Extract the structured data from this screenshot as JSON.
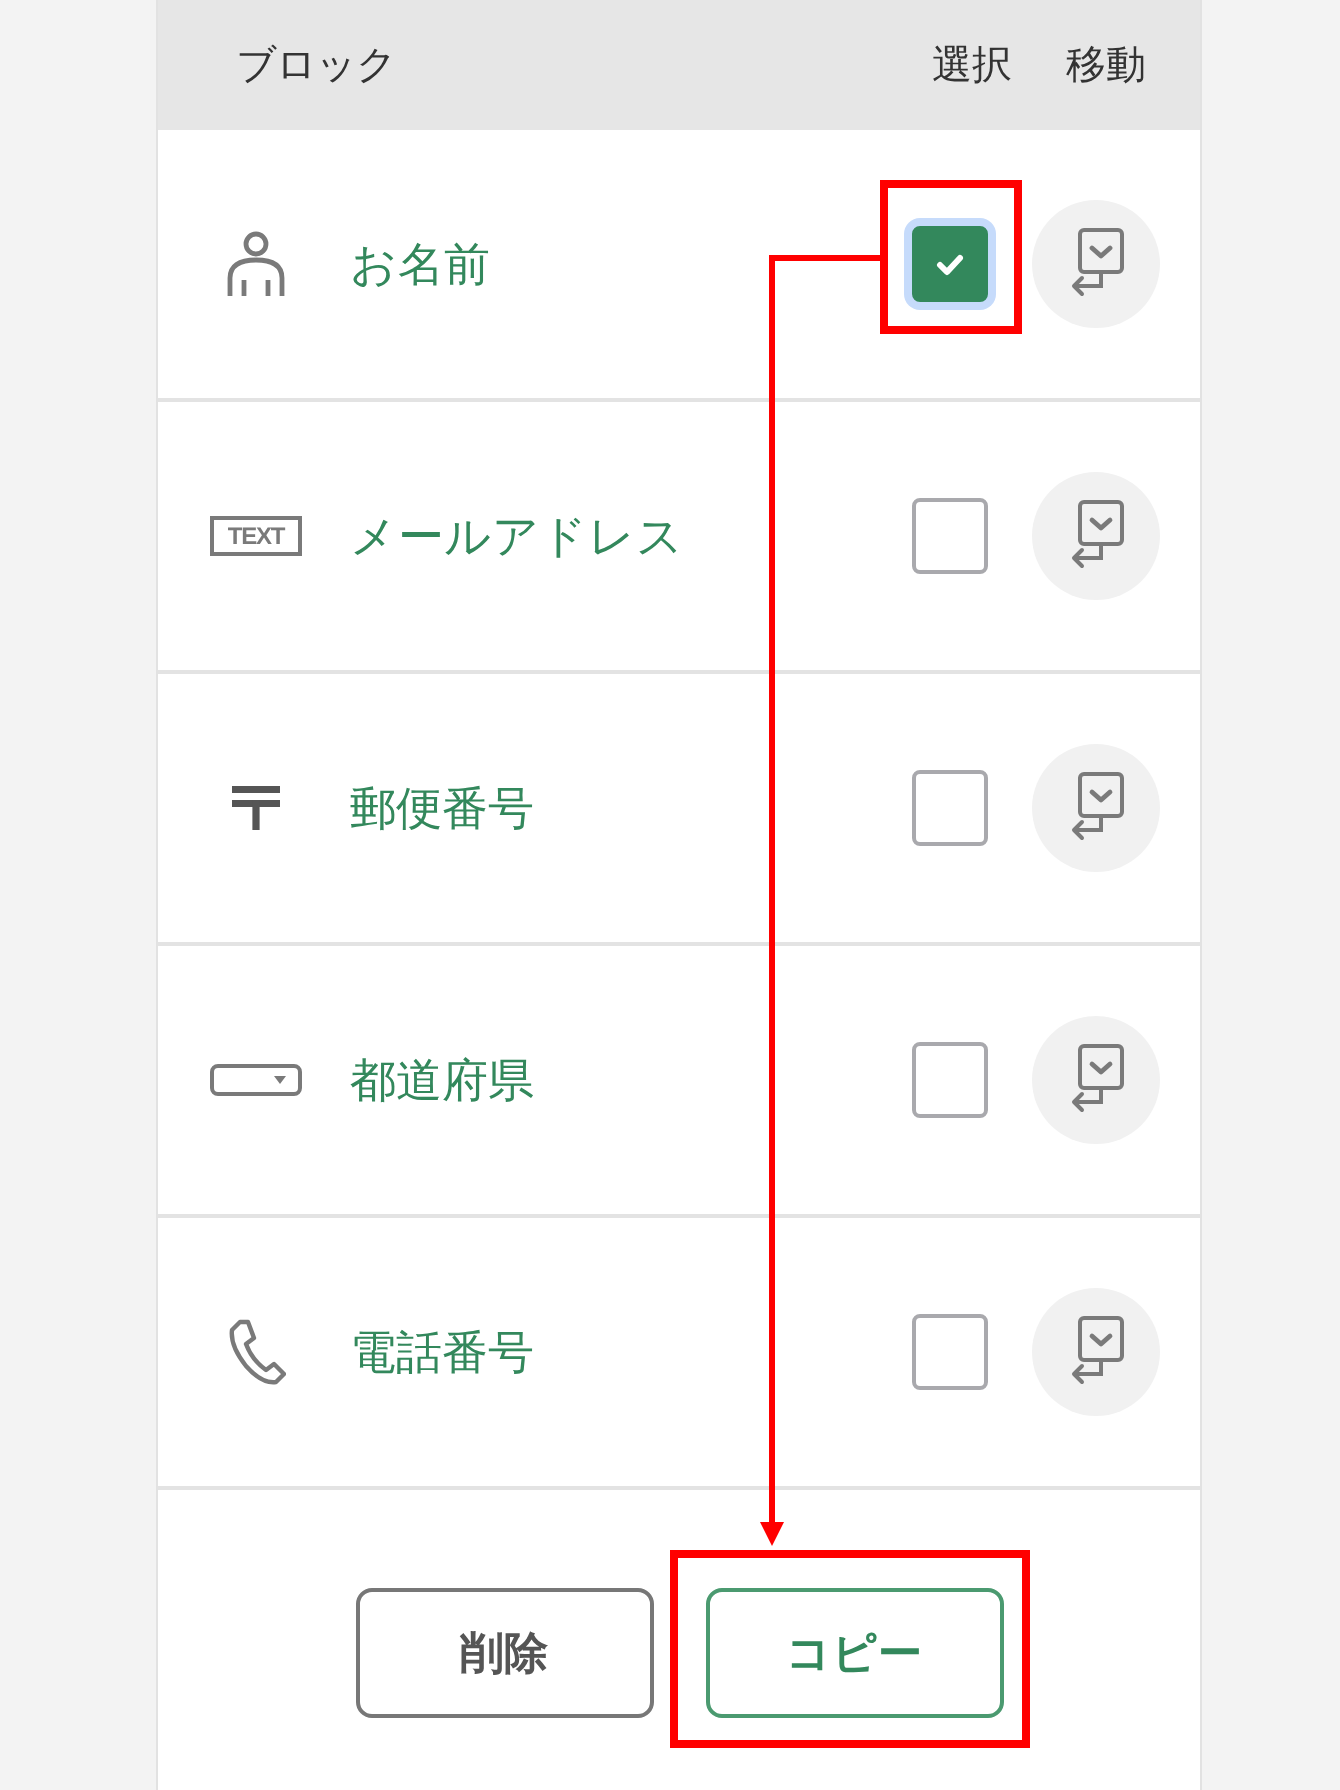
{
  "header": {
    "block_column": "ブロック",
    "select_column": "選択",
    "move_column": "移動"
  },
  "blocks": [
    {
      "kind": "person",
      "label": "お名前",
      "checked": true,
      "highlighted": true
    },
    {
      "kind": "text",
      "badge": "TEXT",
      "label": "メールアドレス",
      "checked": false,
      "highlighted": false
    },
    {
      "kind": "postal",
      "label": "郵便番号",
      "checked": false,
      "highlighted": false
    },
    {
      "kind": "dropdown",
      "label": "都道府県",
      "checked": false,
      "highlighted": false
    },
    {
      "kind": "phone",
      "label": "電話番号",
      "checked": false,
      "highlighted": false
    }
  ],
  "buttons": [
    {
      "kind": "secondary",
      "label": "削除",
      "highlighted": false
    },
    {
      "kind": "primary",
      "label": "コピー",
      "highlighted": true
    }
  ]
}
